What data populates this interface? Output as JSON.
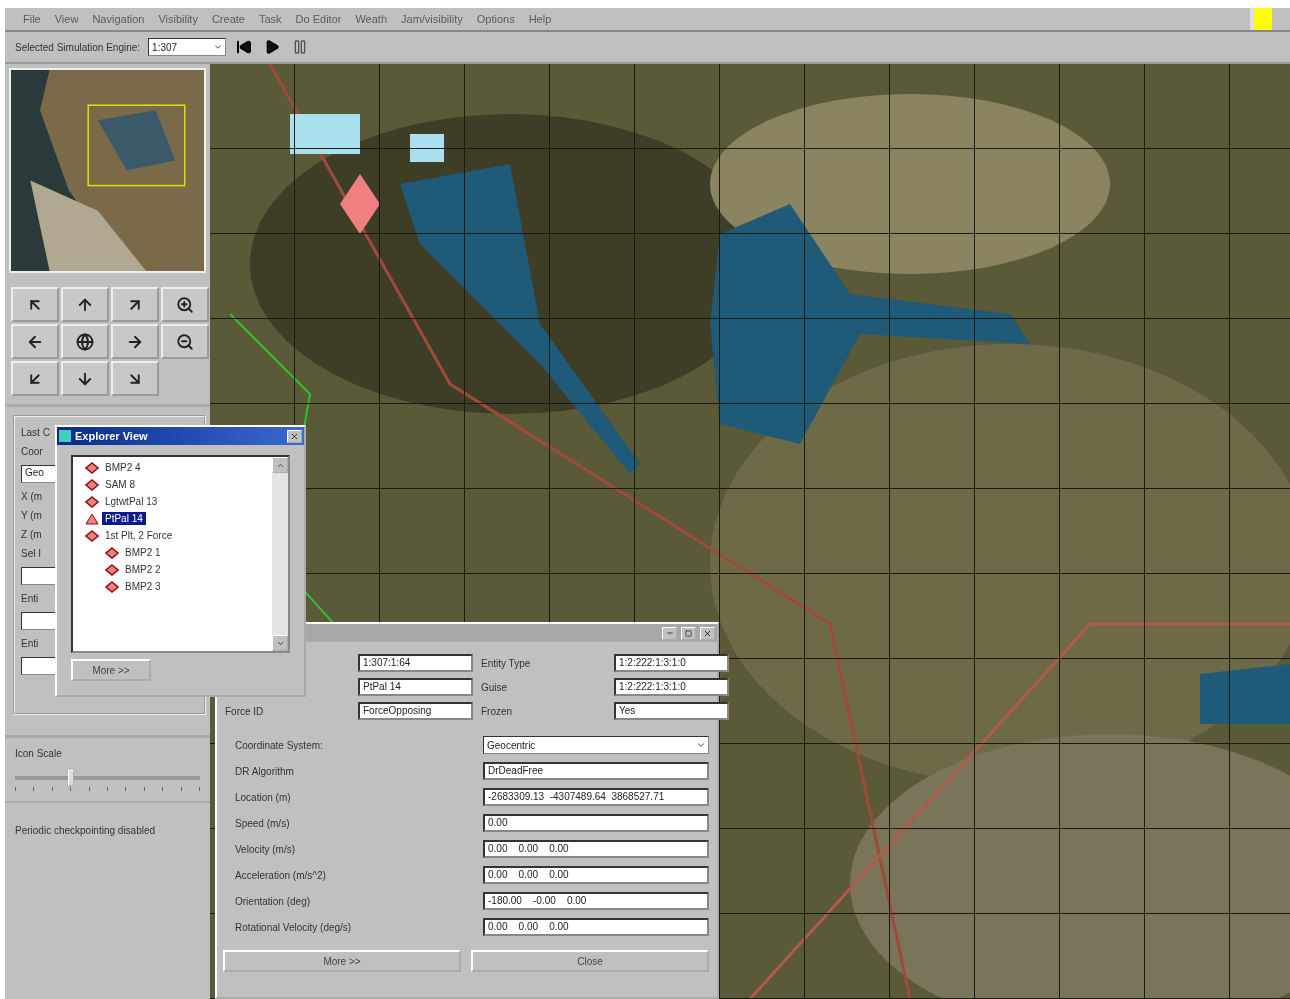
{
  "menu": [
    "File",
    "View",
    "Navigation",
    "Visibility",
    "Create",
    "Task",
    "Do Editor",
    "Weath",
    "Jam/visibility",
    "Options",
    "Help"
  ],
  "status_light": {
    "color": "#ffff00"
  },
  "toolbar": {
    "engine_label": "Selected Simulation Engine:",
    "engine_value": "1:307"
  },
  "left_panel": {
    "labels": [
      "Last C",
      "Coor"
    ],
    "select_value": "Geo",
    "axis_labels": [
      "X (m",
      "Y (m",
      "Z (m",
      "Sel I"
    ],
    "entity_labels": [
      "Enti",
      "Enti"
    ],
    "icon_scale": {
      "label": "Icon Scale",
      "level": 0.3
    },
    "status": "Periodic checkpointing disabled"
  },
  "explorer": {
    "title": "Explorer View",
    "items": [
      {
        "label": "BMP2 4",
        "selected": false
      },
      {
        "label": "SAM 8",
        "selected": false
      },
      {
        "label": "LgtwtPal 13",
        "selected": false
      },
      {
        "label": "PtPal 14",
        "selected": true
      },
      {
        "label": "1st Plt, 2 Force",
        "selected": false,
        "children": [
          {
            "label": "BMP2 1",
            "selected": false
          },
          {
            "label": "BMP2 2",
            "selected": false
          },
          {
            "label": "BMP2 3",
            "selected": false
          }
        ]
      }
    ],
    "button": "More >>"
  },
  "entity_dialog": {
    "top_fields": [
      {
        "value": "1:307:1:64",
        "label2": "Entity Type",
        "value2": "1:2:222:1:3:1:0"
      },
      {
        "value": "PtPal 14",
        "label2": "Guise",
        "value2": "1:2:222:1:3:1:0"
      },
      {
        "label": "Force ID",
        "value": "ForceOpposing",
        "label2": "Frozen",
        "value2": "Yes"
      }
    ],
    "rows": [
      {
        "kind": "select",
        "label": "Coordinate System:",
        "value": "Geocentric"
      },
      {
        "kind": "text",
        "label": "DR Algorithm",
        "value": "DrDeadFree"
      },
      {
        "kind": "text",
        "label": "Location (m)",
        "value": "-2683309.13  -4307489.64  3868527.71"
      },
      {
        "kind": "text",
        "label": "Speed (m/s)",
        "value": "0.00"
      },
      {
        "kind": "text",
        "label": "Velocity (m/s)",
        "value": "0.00    0.00    0.00"
      },
      {
        "kind": "text",
        "label": "Acceleration (m/s^2)",
        "value": "0.00    0.00    0.00"
      },
      {
        "kind": "text",
        "label": "Orientation (deg)",
        "value": "-180.00    -0.00    0.00"
      },
      {
        "kind": "text",
        "label": "Rotational Velocity (deg/s)",
        "value": "0.00    0.00    0.00"
      }
    ],
    "buttons": [
      "More >>",
      "Close"
    ]
  }
}
